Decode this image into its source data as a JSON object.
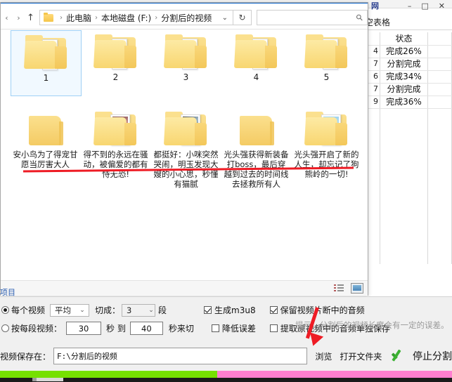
{
  "background_app": {
    "window_controls": [
      "–",
      "□",
      "✕"
    ],
    "logo": "网",
    "ribbon_label": "空表格",
    "table": {
      "header": {
        "col_a": "",
        "col_b": "状态"
      },
      "rows": [
        {
          "col_a": "4",
          "col_b": "完成26%"
        },
        {
          "col_a": "7",
          "col_b": "分割完成"
        },
        {
          "col_a": "6",
          "col_b": "完成34%"
        },
        {
          "col_a": "7",
          "col_b": "分割完成"
        },
        {
          "col_a": "9",
          "col_b": "完成36%"
        }
      ]
    }
  },
  "explorer": {
    "nav": {
      "back": "‹",
      "forward": "›",
      "up": "↑",
      "dropdown_caret": "⌄",
      "refresh": "↻",
      "search_placeholder": "",
      "search_icon": "⚲"
    },
    "breadcrumb": [
      "此电脑",
      "本地磁盘 (F:)",
      "分割后的视频"
    ],
    "breadcrumb_separator": "›",
    "items": [
      {
        "label": "1",
        "type": "folder-docs",
        "selected": true
      },
      {
        "label": "2",
        "type": "folder-docs",
        "selected": false
      },
      {
        "label": "3",
        "type": "folder-docs",
        "selected": false
      },
      {
        "label": "4",
        "type": "folder-docs",
        "selected": false
      },
      {
        "label": "5",
        "type": "folder-docs",
        "selected": false
      },
      {
        "label": "安小鸟为了得宠甘愿当厉害大人",
        "type": "folder-empty",
        "selected": false
      },
      {
        "label": "得不到的永远在骚动，被偏爱的都有恃无恐!",
        "type": "folder-photo",
        "selected": false
      },
      {
        "label": "都挺好：小咪突然哭闹，明玉发现大嫂的小心思，秒懂有猫腻",
        "type": "folder-photo2",
        "selected": false
      },
      {
        "label": "光头强获得新装备打boss，最后穿越到过去的时间线去拯救所有人",
        "type": "folder-empty",
        "selected": false
      },
      {
        "label": "光头强开启了新的人生，却忘记了狗熊岭的一切!",
        "type": "folder-photo3",
        "selected": false
      }
    ],
    "statusbar": {
      "view_list_icon": "list-view-icon",
      "view_tile_icon": "tile-view-icon"
    }
  },
  "panel": {
    "tab_label": "项目",
    "options": {
      "radio_per_video": {
        "checked": true,
        "label": "每个视频"
      },
      "mode_select": {
        "value": "平均",
        "caret": "⌄"
      },
      "cut_into_label": "切成：",
      "segments_select": {
        "value": "3",
        "caret": "⌄"
      },
      "segments_unit": "段",
      "radio_by_segment": {
        "checked": false,
        "label": "按每段视频："
      },
      "from_value": "30",
      "unit_sec_to": "秒 到",
      "to_value": "40",
      "unit_sec_cut": "秒来切",
      "chk_gen_m3u8": {
        "checked": true,
        "label": "生成m3u8"
      },
      "chk_keep_audio": {
        "checked": true,
        "label": "保留视频片断中的音频"
      },
      "chk_reduce_error": {
        "checked": false,
        "label": "降低误差"
      },
      "chk_extract_audio": {
        "checked": false,
        "label": "提取原视频中的音频单独保存"
      }
    },
    "hint": "提示：分割后的视频长度会有一定的误差。",
    "save_row": {
      "label": "视频保存在：",
      "path_value": "F:\\分割后的视频",
      "browse_label": "浏览",
      "open_folder_label": "打开文件夹",
      "check_icon": "green-check-icon",
      "stop_label": "停止分割"
    },
    "progress": {
      "percent": 48,
      "fill_color": "#76e000",
      "track_color": "#ff7fd0"
    }
  },
  "annotations": {
    "red_underline_color": "#ee1b24",
    "arrow_color": "#ee1b24"
  }
}
